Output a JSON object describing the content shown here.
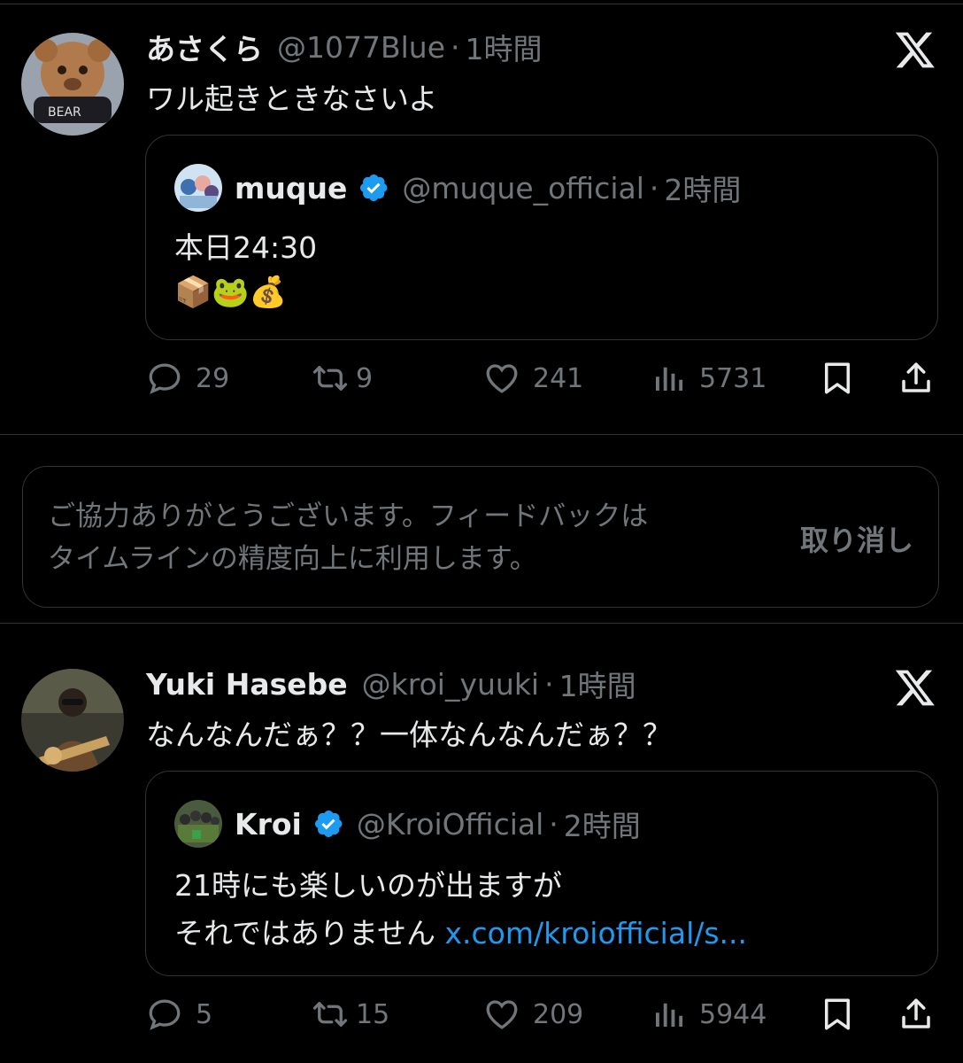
{
  "tweets": [
    {
      "name": "あさくら",
      "handle": "@1077Blue",
      "dot": "·",
      "time": "1時間",
      "text": "ワル起きときなさいよ",
      "quote": {
        "name": "muque",
        "handle": "@muque_official",
        "dot": "·",
        "time": "2時間",
        "lines": [
          "本日24:30",
          "📦🐸💰"
        ],
        "link": ""
      },
      "stats": {
        "replies": "29",
        "retweets": "9",
        "likes": "241",
        "views": "5731"
      }
    },
    {
      "name": "Yuki Hasebe",
      "handle": "@kroi_yuuki",
      "dot": "·",
      "time": "1時間",
      "text": "なんなんだぁ？？一体なんなんだぁ？？",
      "quote": {
        "name": "Kroi",
        "handle": "@KroiOfficial",
        "dot": "·",
        "time": "2時間",
        "lines": [
          "21時にも楽しいのが出ますが",
          "それではありません "
        ],
        "link": "x.com/kroiofficial/s..."
      },
      "stats": {
        "replies": "5",
        "retweets": "15",
        "likes": "209",
        "views": "5944"
      }
    }
  ],
  "feedback": {
    "message_line1": "ご協力ありがとうございます。フィードバックは",
    "message_line2": "タイムラインの精度向上に利用します。",
    "undo_label": "取り消し"
  },
  "icons": {
    "reply": "reply-icon",
    "retweet": "retweet-icon",
    "like": "heart-icon",
    "views": "views-icon",
    "bookmark": "bookmark-icon",
    "share": "share-icon",
    "x_logo": "x-logo-icon",
    "verified": "verified-badge-icon"
  },
  "colors": {
    "background": "#000000",
    "text": "#e7e9ea",
    "muted": "#71767b",
    "link": "#1d9bf0",
    "border": "#2f3336"
  }
}
